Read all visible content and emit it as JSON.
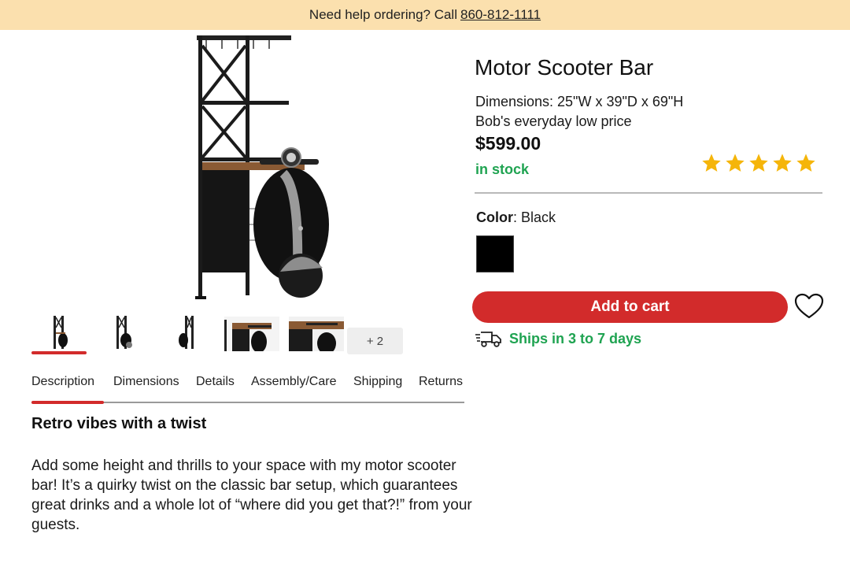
{
  "banner": {
    "text": "Need help ordering? Call",
    "phone": "860-812-1111"
  },
  "product": {
    "title": "Motor Scooter Bar",
    "dimensions": "Dimensions: 25\"W x 39\"D x 69\"H",
    "price_note": "Bob's everyday low price",
    "price": "$599.00",
    "stock_status": "in stock",
    "rating": 5,
    "rating_max": 5,
    "color_label": "Color",
    "color_value": "Black",
    "swatch_color": "#000000",
    "add_to_cart_label": "Add to cart",
    "shipping_text": "Ships in 3 to 7 days"
  },
  "gallery": {
    "more_count": "+ 2"
  },
  "tabs": [
    {
      "label": "Description"
    },
    {
      "label": "Dimensions"
    },
    {
      "label": "Details"
    },
    {
      "label": "Assembly/Care"
    },
    {
      "label": "Shipping"
    },
    {
      "label": "Returns"
    }
  ],
  "description": {
    "heading": "Retro vibes with a twist",
    "body": "Add some height and thrills to your space with my motor scooter bar! It’s a quirky twist on the classic bar setup, which guarantees great drinks and a whole lot of “where did you get that?!” from your guests."
  },
  "colors": {
    "accent_red": "#d22b2b",
    "stock_green": "#1fa351",
    "banner_bg": "#fbe0ae",
    "star_gold": "#f5b50a"
  },
  "icons": {
    "wishlist": "heart-icon",
    "shipping": "delivery-truck-icon",
    "rating": "star-icon"
  }
}
